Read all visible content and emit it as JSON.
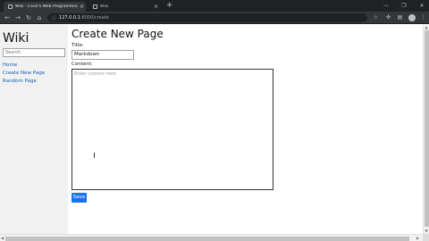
{
  "browser": {
    "tabs": [
      {
        "title": "Wiki - CS50's Web Programming",
        "active": true
      },
      {
        "title": "Wiki",
        "active": false
      }
    ],
    "url_host": "127.0.0.1",
    "url_path": ":8000/create"
  },
  "icons": {
    "back": "back-arrow-icon",
    "forward": "forward-arrow-icon",
    "reload": "reload-icon",
    "home": "home-icon",
    "lock": "lock-icon",
    "bookmark": "star-icon",
    "extensions": "puzzle-icon",
    "menu": "kebab-menu-icon"
  },
  "sidebar": {
    "site_title": "Wiki",
    "search_placeholder": "Search",
    "links": [
      "Home",
      "Create New Page",
      "Random Page"
    ]
  },
  "main": {
    "heading": "Create New Page",
    "title_label": "Title:",
    "title_value": "Markdown",
    "content_label": "Content:",
    "content_placeholder": "Enter content here",
    "save_label": "Save"
  },
  "colors": {
    "accent": "#1a73e8",
    "link": "#1a5fb4",
    "sidebar_bg": "#f1f1f1",
    "chrome_dark": "#202124"
  }
}
